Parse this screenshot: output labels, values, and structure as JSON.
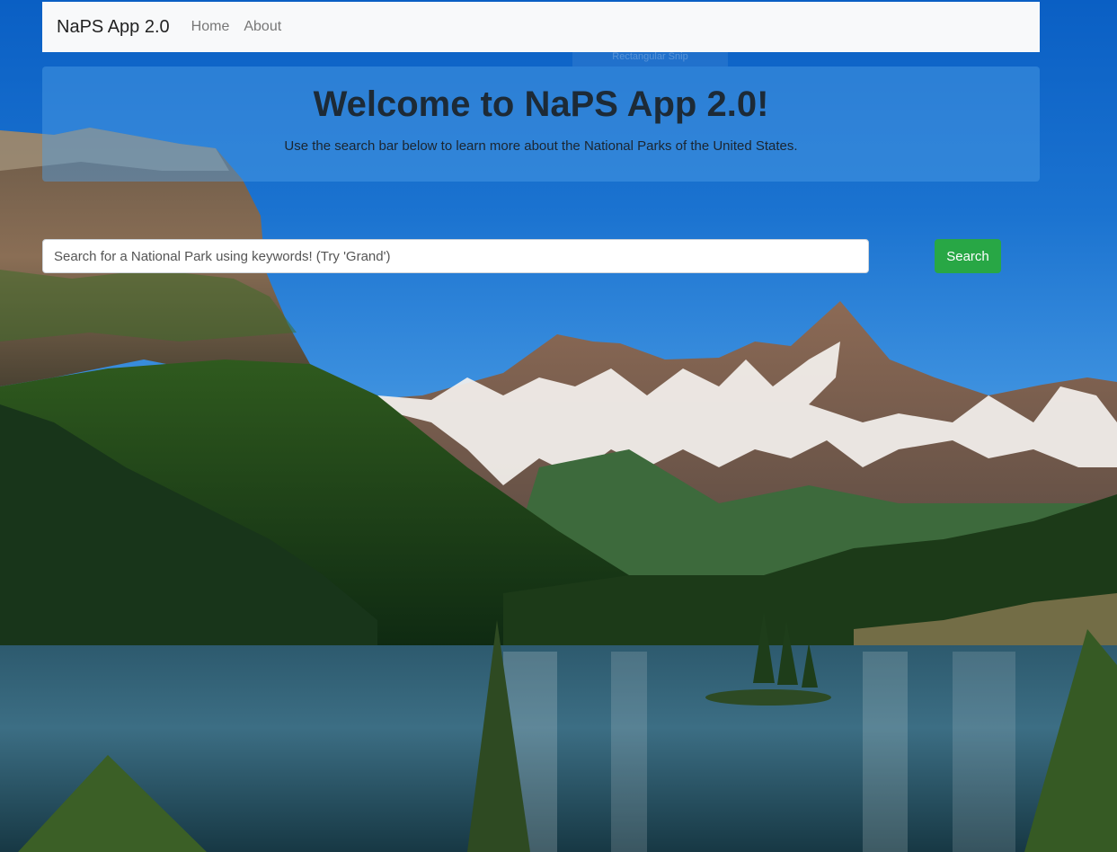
{
  "navbar": {
    "brand": "NaPS App 2.0",
    "links": [
      {
        "label": "Home"
      },
      {
        "label": "About"
      }
    ]
  },
  "overlay": {
    "snip_label": "Rectangular Snip"
  },
  "hero": {
    "title": "Welcome to NaPS App 2.0!",
    "subtitle": "Use the search bar below to learn more about the National Parks of the United States."
  },
  "search": {
    "placeholder": "Search for a National Park using keywords! (Try 'Grand')",
    "value": "",
    "button_label": "Search"
  },
  "colors": {
    "navbar_bg": "#f8f9fa",
    "search_button": "#28a745",
    "hero_panel": "#50a0e6"
  }
}
